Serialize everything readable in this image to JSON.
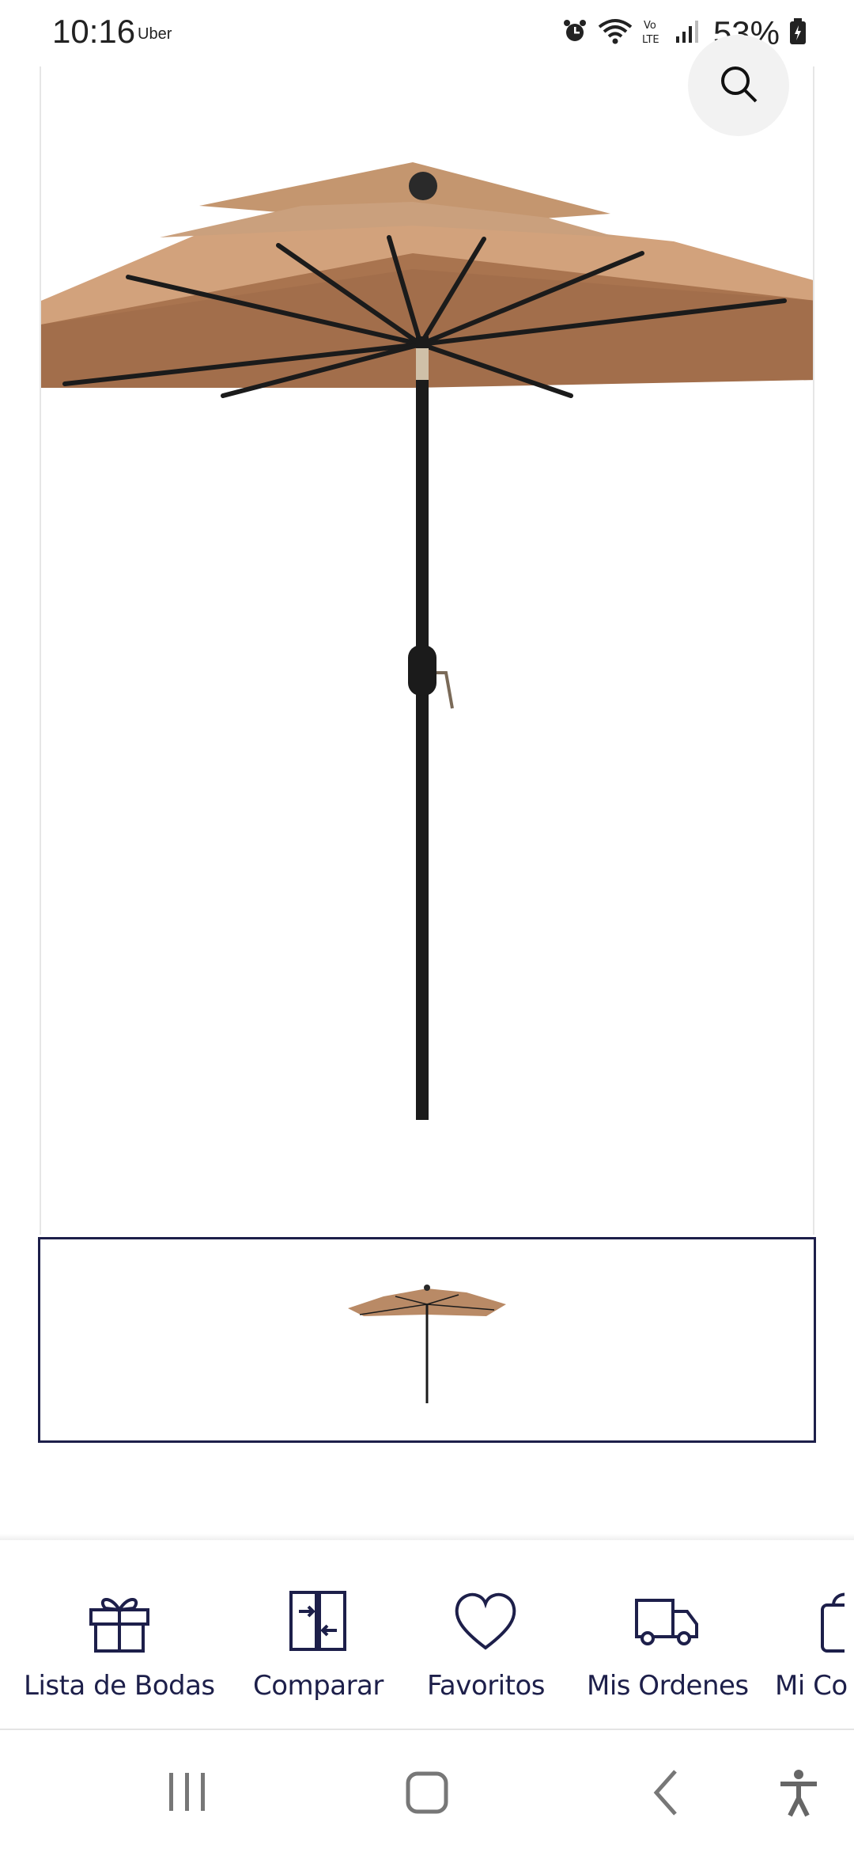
{
  "status_bar": {
    "time": "10:16",
    "app": "Uber",
    "battery": "53%"
  },
  "product_gallery": {
    "zoom_icon": "zoom-icon",
    "umbrella_canopy_color": "#b98a66",
    "umbrella_pole_color": "#1b1b1b"
  },
  "action_bar": {
    "items": [
      {
        "label": "Lista de Bodas",
        "icon": "gift-icon"
      },
      {
        "label": "Comparar",
        "icon": "compare-icon"
      },
      {
        "label": "Favoritos",
        "icon": "heart-icon"
      },
      {
        "label": "Mis Ordenes",
        "icon": "truck-icon"
      },
      {
        "label": "Mi Co",
        "icon": "bag-icon"
      }
    ]
  },
  "nav_bar": {
    "recents_icon": "recents-icon",
    "home_icon": "home-icon",
    "back_icon": "back-icon",
    "accessibility_icon": "accessibility-icon"
  },
  "colors": {
    "accent": "#1d1f4a",
    "border": "#e6e6e6"
  }
}
